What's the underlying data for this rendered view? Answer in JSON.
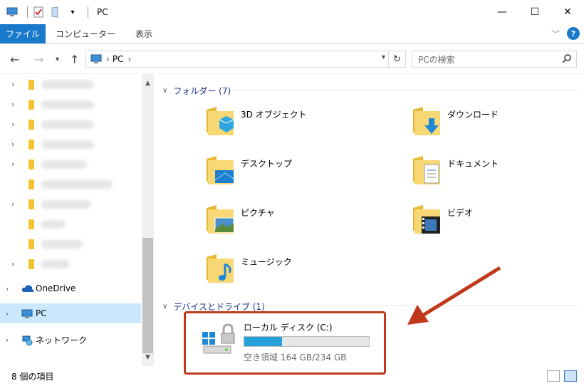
{
  "window": {
    "title": "PC",
    "controls": {
      "minimize": "—",
      "maximize": "☐",
      "close": "✕"
    }
  },
  "ribbon": {
    "file_tab": "ファイル",
    "tabs": [
      "コンピューター",
      "表示"
    ],
    "help": "?"
  },
  "address": {
    "path_root": "PC",
    "separator": "›",
    "search_placeholder": "PCの検索"
  },
  "nav": {
    "quick_items_blurred": 9,
    "onedrive": "OneDrive",
    "pc": "PC",
    "network": "ネットワーク"
  },
  "folders": {
    "header": "フォルダー (7)",
    "items": [
      {
        "label": "3D オブジェクト",
        "icon": "3d-objects-folder-icon"
      },
      {
        "label": "ダウンロード",
        "icon": "downloads-folder-icon"
      },
      {
        "label": "デスクトップ",
        "icon": "desktop-folder-icon"
      },
      {
        "label": "ドキュメント",
        "icon": "documents-folder-icon"
      },
      {
        "label": "ピクチャ",
        "icon": "pictures-folder-icon"
      },
      {
        "label": "ビデオ",
        "icon": "videos-folder-icon"
      },
      {
        "label": "ミュージック",
        "icon": "music-folder-icon"
      }
    ]
  },
  "devices": {
    "header": "デバイスとドライブ (1)",
    "drive": {
      "name": "ローカル ディスク (C:)",
      "free_text": "空き領域 164 GB/234 GB",
      "used_fraction": 0.3
    }
  },
  "status": {
    "items_count": "8 個の項目"
  },
  "colors": {
    "accent": "#1979ca",
    "selected": "#cce8ff",
    "drive_bar": "#26a0da",
    "annotation": "#c1391c",
    "folder": "#f4c430"
  }
}
